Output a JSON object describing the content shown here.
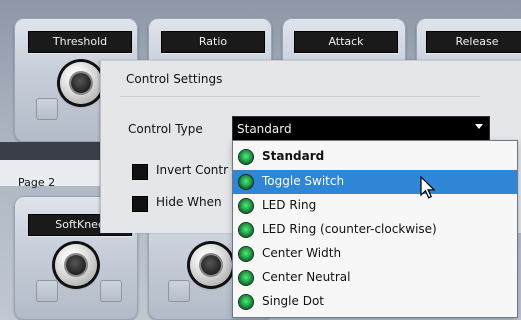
{
  "rack": {
    "top_labels": [
      "Threshold",
      "Ratio",
      "Attack",
      "Release"
    ],
    "page_label": "Page 2",
    "bottom_labels": [
      "SoftKnee"
    ]
  },
  "settings": {
    "title": "Control Settings",
    "control_type_label": "Control Type",
    "control_type_value": "Standard",
    "invert_label": "Invert Contr",
    "hide_label": "Hide When"
  },
  "dropdown": {
    "options": [
      {
        "label": "Standard",
        "bold": true
      },
      {
        "label": "Toggle Switch",
        "highlighted": true
      },
      {
        "label": "LED Ring"
      },
      {
        "label": "LED Ring (counter-clockwise)"
      },
      {
        "label": "Center Width"
      },
      {
        "label": "Center Neutral"
      },
      {
        "label": "Single Dot"
      }
    ],
    "highlight_color": "#2f86d6",
    "dot_color": "#1ea64a"
  },
  "icons": {
    "knob": "knob-icon",
    "option_dot": "green-led-icon",
    "cursor": "mouse-pointer-icon"
  }
}
